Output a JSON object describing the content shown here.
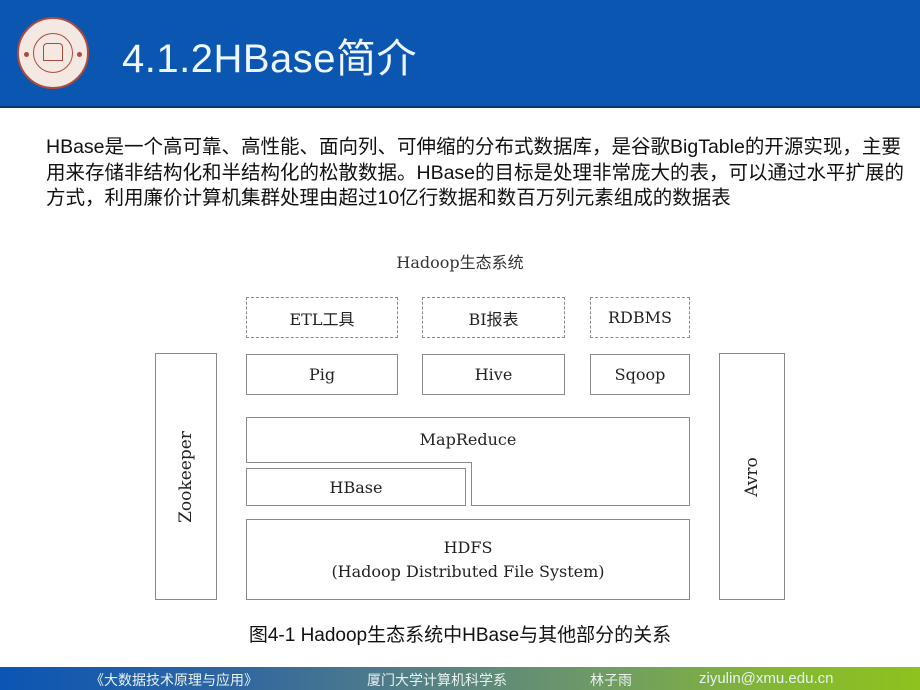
{
  "header": {
    "title": "4.1.2HBase简介",
    "logo": "xiamen-university-seal-logo"
  },
  "body": {
    "paragraph": "HBase是一个高可靠、高性能、面向列、可伸缩的分布式数据库，是谷歌BigTable的开源实现，主要用来存储非结构化和半结构化的松散数据。HBase的目标是处理非常庞大的表，可以通过水平扩展的方式，利用廉价计算机集群处理由超过10亿行数据和数百万列元素组成的数据表"
  },
  "diagram": {
    "title": "Hadoop生态系统",
    "top_row": [
      "ETL工具",
      "BI报表",
      "RDBMS"
    ],
    "second_row": [
      "Pig",
      "Hive",
      "Sqoop"
    ],
    "mapreduce": "MapReduce",
    "hbase": "HBase",
    "hdfs": "HDFS",
    "hdfs_full": "(Hadoop Distributed File System)",
    "left_side": "Zookeeper",
    "right_side": "Avro",
    "caption": "图4-1 Hadoop生态系统中HBase与其他部分的关系"
  },
  "footer": {
    "book": "《大数据技术原理与应用》",
    "department": "厦门大学计算机科学系",
    "author": "林子雨",
    "email": "ziyulin@xmu.edu.cn"
  }
}
